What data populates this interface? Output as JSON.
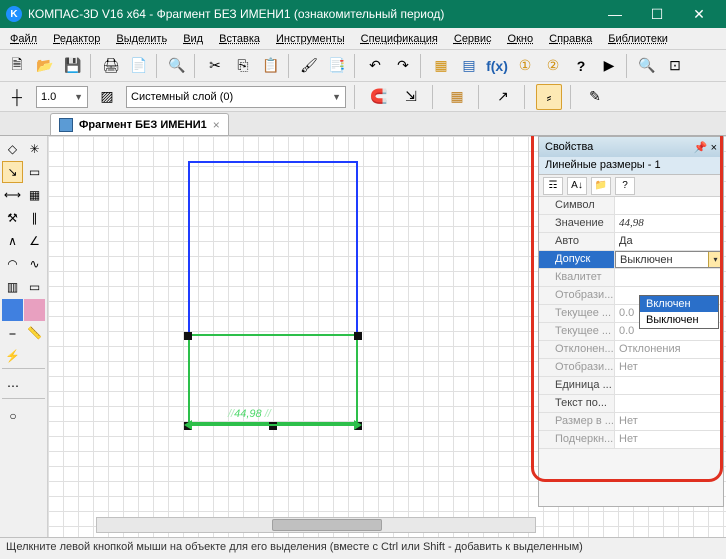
{
  "window": {
    "logo_text": "K",
    "title": "КОМПАС-3D V16  x64 - Фрагмент БЕЗ ИМЕНИ1 (ознакомительный период)"
  },
  "menu": [
    "Файл",
    "Редактор",
    "Выделить",
    "Вид",
    "Вставка",
    "Инструменты",
    "Спецификация",
    "Сервис",
    "Окно",
    "Справка",
    "Библиотеки"
  ],
  "toolbar1_icons": [
    "new",
    "open",
    "save",
    "print",
    "preview",
    "pdf",
    "cut",
    "copy",
    "paste",
    "brush",
    "props",
    "undo",
    "redo",
    "lib",
    "vars",
    "fx",
    "d1",
    "d2",
    "help",
    "run",
    "zoom-in",
    "zoom-extents"
  ],
  "row2": {
    "scale_value": "1.0",
    "layer_value": "Системный слой (0)",
    "icons": [
      "layers",
      "magnet",
      "axis",
      "grid",
      "snap",
      "ortho",
      "edit"
    ]
  },
  "doc_tab": {
    "label": "Фрагмент БЕЗ ИМЕНИ1"
  },
  "left_tool_icons": [
    [
      "geo1",
      "geo2"
    ],
    [
      "line",
      "sel"
    ],
    [
      "dim",
      "hatch"
    ],
    [
      "ham",
      "para"
    ],
    [
      "axis2",
      "ang"
    ],
    [
      "arc",
      "curve"
    ],
    [
      "table",
      "rect"
    ],
    [
      "blue",
      "pink"
    ],
    [
      "seg",
      "ruler"
    ],
    [
      "flash",
      "empty"
    ],
    [
      "sep",
      "sep"
    ],
    [
      "dline",
      "empty"
    ],
    [
      "sep",
      "sep"
    ],
    [
      "circ",
      "empty"
    ]
  ],
  "drawing": {
    "dim_value": "44,98",
    "dim_prefix": "//",
    "dim_suffix": " //"
  },
  "properties": {
    "panel_title": "Свойства",
    "subtitle": "Линейные размеры - 1",
    "tool_icons": [
      "cat",
      "az",
      "folder",
      "help"
    ],
    "rows": [
      {
        "name": "Символ",
        "val": "",
        "plain": true
      },
      {
        "name": "Значение",
        "val": "44,98"
      },
      {
        "name": "Авто",
        "val": "Да",
        "plain": true
      },
      {
        "name": "Допуск",
        "val": "Выключен",
        "sel": true,
        "plain": true
      },
      {
        "name": "Квалитет",
        "val": "",
        "dis": true
      },
      {
        "name": "Отобрази...",
        "val": "",
        "dis": true
      },
      {
        "name": "Текущее ...",
        "val": "0.0",
        "dis": true,
        "plain": true
      },
      {
        "name": "Текущее ...",
        "val": "0.0",
        "dis": true,
        "plain": true
      },
      {
        "name": "Отклонен...",
        "val": "Отклонения",
        "dis": true,
        "plain": true
      },
      {
        "name": "Отобрази...",
        "val": "Нет",
        "dis": true,
        "plain": true
      },
      {
        "name": "Единица ...",
        "val": ""
      },
      {
        "name": "Текст по...",
        "val": ""
      },
      {
        "name": "Размер в ...",
        "val": "Нет",
        "dis": true,
        "plain": true
      },
      {
        "name": "Подчеркн...",
        "val": "Нет",
        "dis": true,
        "plain": true
      }
    ],
    "dropdown_options": [
      "Включен",
      "Выключен"
    ],
    "dropdown_selected": 0
  },
  "status": "Щелкните левой кнопкой мыши на объекте для его выделения (вместе с Ctrl или Shift - добавить к выделенным)"
}
